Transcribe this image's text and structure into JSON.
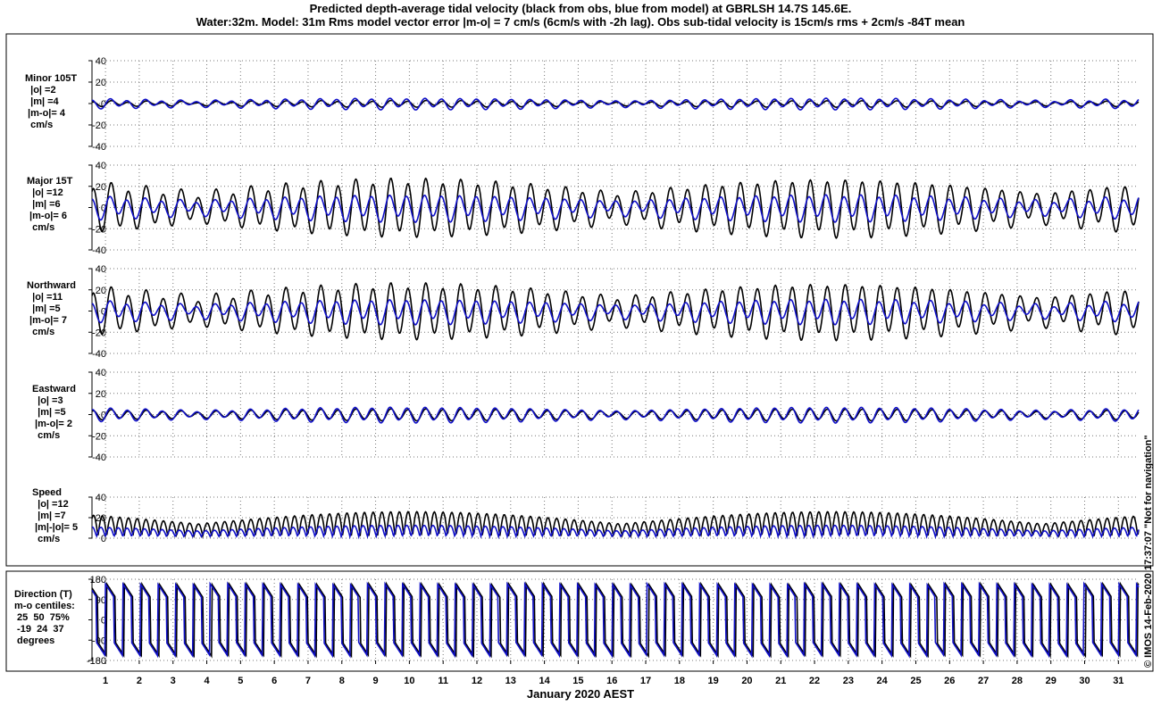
{
  "title": {
    "line1": "Predicted depth-average tidal velocity (black from obs, blue from model) at GBRLSH 14.7S 145.6E.",
    "line2": "Water:32m. Model: 31m  Rms model vector error |m-o| = 7 cm/s (6cm/s with -2h lag). Obs sub-tidal velocity is 15cm/s rms + 2cm/s -84T mean"
  },
  "panels": [
    {
      "label": "Minor 105T\n  |o| =2\n  |m| =4\n |m-o|= 4\n  cm/s",
      "ylim": [
        -40,
        40
      ],
      "ticks": [
        -40,
        -20,
        0,
        20,
        40
      ]
    },
    {
      "label": "Major 15T\n  |o| =12\n  |m| =6\n |m-o|= 6\n  cm/s",
      "ylim": [
        -40,
        40
      ],
      "ticks": [
        -40,
        -20,
        0,
        20,
        40
      ]
    },
    {
      "label": "Northward\n  |o| =11\n  |m| =5\n |m-o|= 7\n  cm/s",
      "ylim": [
        -40,
        40
      ],
      "ticks": [
        -40,
        -20,
        0,
        20,
        40
      ]
    },
    {
      "label": "Eastward\n  |o| =3\n  |m| =5\n |m-o|= 2\n  cm/s",
      "ylim": [
        -40,
        40
      ],
      "ticks": [
        -40,
        -20,
        0,
        20,
        40
      ]
    },
    {
      "label": "Speed\n  |o| =12\n  |m| =7\n |m|-|o|= 5\n  cm/s",
      "ylim": [
        0,
        40
      ],
      "ticks": [
        0,
        20,
        40
      ]
    },
    {
      "label": "Direction (T)\nm-o centiles:\n 25  50  75%\n -19  24  37\n degrees",
      "ylim": [
        -180,
        180
      ],
      "ticks": [
        -180,
        -90,
        0,
        90,
        180
      ]
    }
  ],
  "xaxis": {
    "label": "January 2020 AEST",
    "ticks": [
      "1",
      "2",
      "3",
      "4",
      "5",
      "6",
      "7",
      "8",
      "9",
      "10",
      "11",
      "12",
      "13",
      "14",
      "15",
      "16",
      "17",
      "18",
      "19",
      "20",
      "21",
      "22",
      "23",
      "24",
      "25",
      "26",
      "27",
      "28",
      "29",
      "30",
      "31"
    ]
  },
  "credit": "© IMOS 14-Feb-2020 17:37:07  \"Not for navigation\"",
  "colors": {
    "obs": "#000000",
    "model": "#1010c8",
    "grid": "#777777"
  },
  "chart_data": {
    "type": "line",
    "title": "Predicted depth-average tidal velocity (black from obs, blue from model) at GBRLSH 14.7S 145.6E.",
    "xlabel": "January 2020 AEST",
    "xlim_days": [
      0.6,
      31.6
    ],
    "series_legend": [
      "black from obs",
      "blue from model"
    ],
    "approx_semidiurnal_amplitude_cm_s": {
      "minor_105T": {
        "obs": 3,
        "model": 5
      },
      "major_15T": {
        "obs_spring_max": 25,
        "model_spring_max": 12
      },
      "northward": {
        "obs_spring_max": 24,
        "model_spring_max": 11
      },
      "eastward": {
        "obs": 5,
        "model": 7
      },
      "speed": {
        "obs_spring_max": 28,
        "model_spring_max": 13
      }
    },
    "spring_tides_days": [
      10,
      22
    ],
    "neap_tides_days": [
      3,
      16,
      29
    ]
  }
}
